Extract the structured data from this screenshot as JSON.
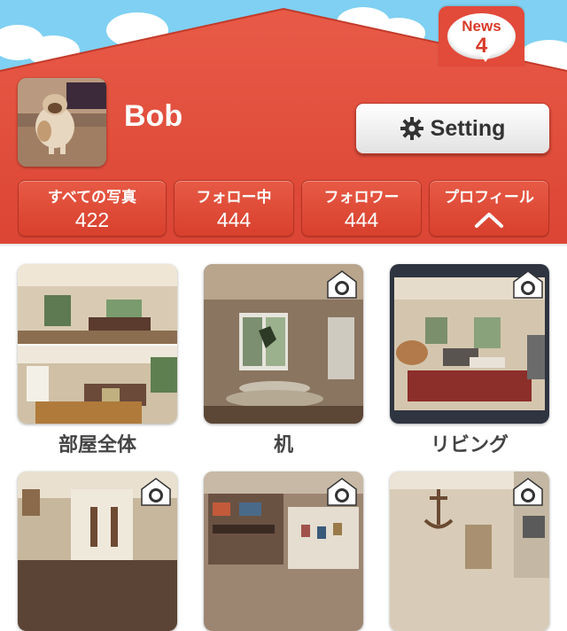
{
  "news": {
    "label": "News",
    "count": "4"
  },
  "profile": {
    "username": "Bob"
  },
  "setting_button": {
    "label": "Setting",
    "icon": "gear-icon"
  },
  "stats": [
    {
      "label": "すべての写真",
      "value": "422"
    },
    {
      "label": "フォロー中",
      "value": "444"
    },
    {
      "label": "フォロワー",
      "value": "444"
    },
    {
      "label": "プロフィール",
      "icon": "chevron-up-icon"
    }
  ],
  "albums": [
    {
      "label": "部屋全体"
    },
    {
      "label": "机"
    },
    {
      "label": "リビング"
    },
    {
      "label": ""
    },
    {
      "label": ""
    },
    {
      "label": ""
    }
  ],
  "colors": {
    "header_red": "#e24a3a",
    "sky": "#7fd0f2",
    "text_gray": "#444444"
  }
}
